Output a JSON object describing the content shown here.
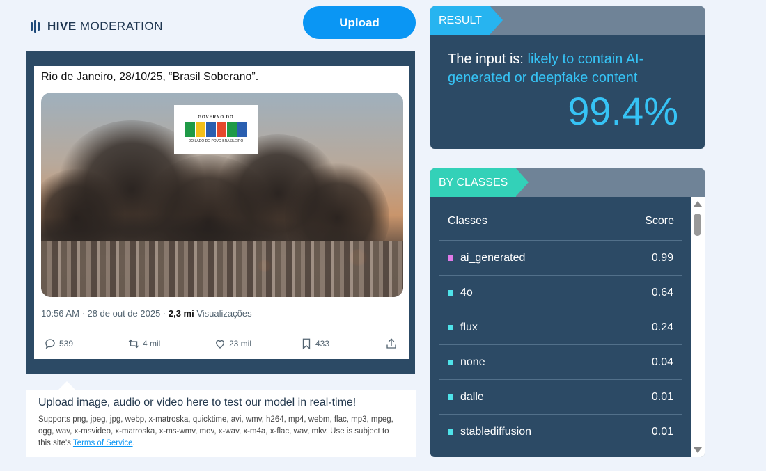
{
  "brand": {
    "name_bold": "HIVE",
    "name_rest": "MODERATION"
  },
  "upload_button": {
    "label": "Upload"
  },
  "tweet": {
    "text": "Rio de Janeiro, 28/10/25, “Brasil Soberano”.",
    "image_logo": {
      "top": "GOVERNO DO",
      "word": "BRASIL",
      "bottom": "DO LADO DO POVO BRASILEIRO"
    },
    "meta": {
      "time": "10:56 AM · 28 de out de 2025 · ",
      "views_count": "2,3 mi",
      "views_label": " Visualizações"
    },
    "actions": {
      "replies": "539",
      "retweets": "4 mil",
      "likes": "23 mil",
      "bookmarks": "433"
    }
  },
  "instructions": {
    "title": "Upload image, audio or video here to test our model in real-time!",
    "text": "Supports png, jpeg, jpg, webp, x-matroska, quicktime, avi, wmv, h264, mp4, webm, flac, mp3, mpeg, ogg, wav, x-msvideo, x-matroska, x-ms-wmv, mov, x-wav, x-m4a, x-flac, wav, mkv. Use is subject to this site's ",
    "link": "Terms of Service",
    "text_end": "."
  },
  "result": {
    "header": "RESULT",
    "prefix": "The input is: ",
    "verdict": "likely to contain AI-generated or deepfake content",
    "score": "99.4%"
  },
  "classes": {
    "header": "BY CLASSES",
    "col_class": "Classes",
    "col_score": "Score",
    "rows": [
      {
        "name": "ai_generated",
        "score": "0.99",
        "color": "#e07ae8"
      },
      {
        "name": "4o",
        "score": "0.64",
        "color": "#4fe3ea"
      },
      {
        "name": "flux",
        "score": "0.24",
        "color": "#4fe3ea"
      },
      {
        "name": "none",
        "score": "0.04",
        "color": "#4fe3ea"
      },
      {
        "name": "dalle",
        "score": "0.01",
        "color": "#4fe3ea"
      },
      {
        "name": "stablediffusion",
        "score": "0.01",
        "color": "#4fe3ea"
      }
    ]
  },
  "colors": {
    "accent": "#0a96f4",
    "panel": "#2c4a65",
    "highlight": "#36c3f5",
    "teal": "#33d1b8"
  }
}
